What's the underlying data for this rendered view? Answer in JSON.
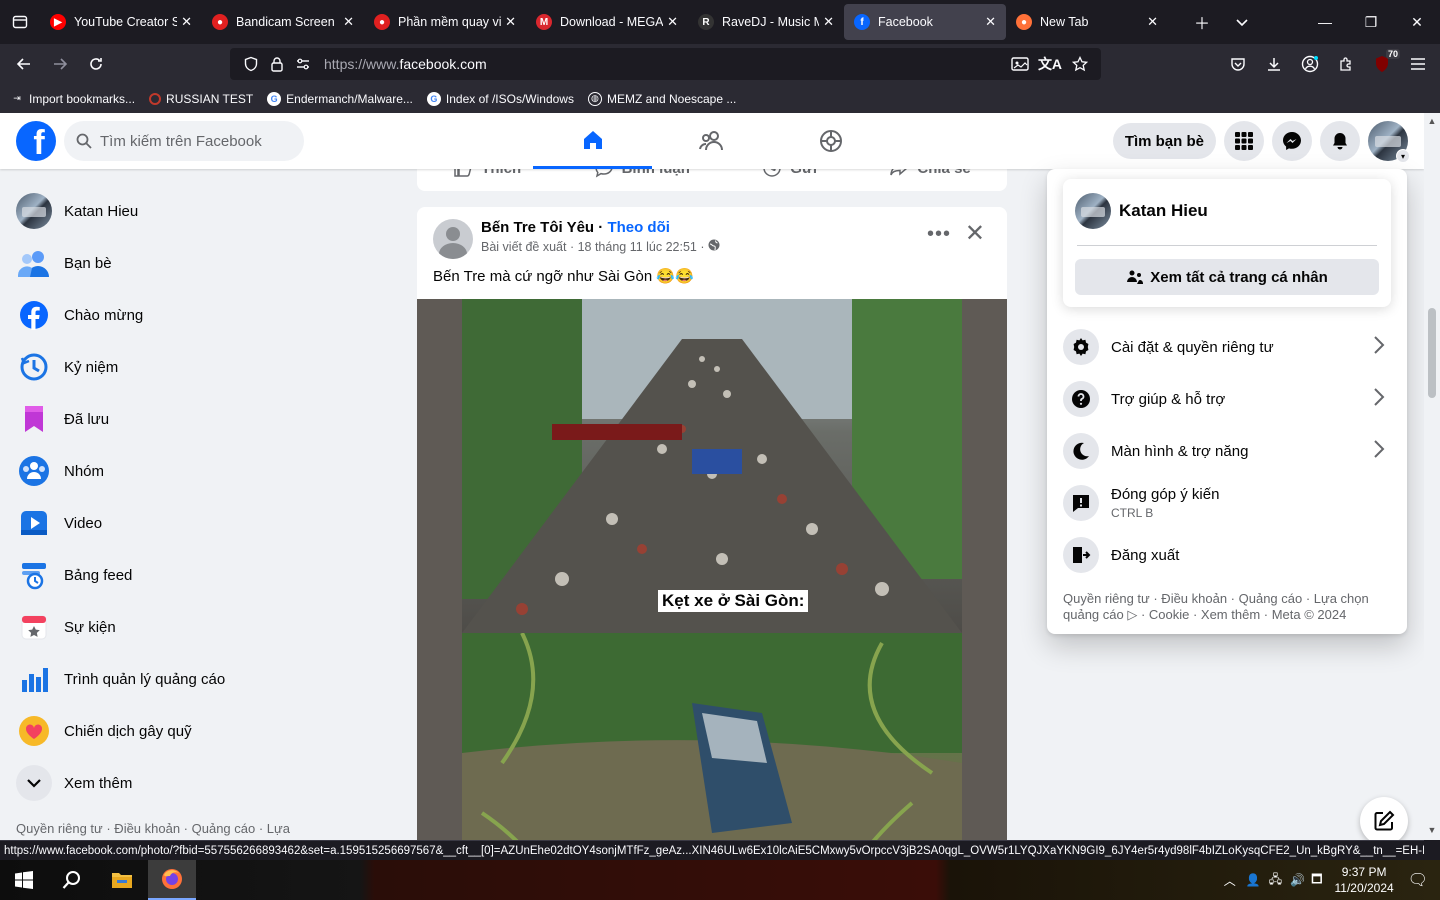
{
  "browser": {
    "tabs": [
      {
        "title": "YouTube Creator St",
        "icon": "youtube-icon",
        "color": "#ff0000"
      },
      {
        "title": "Bandicam Screen Re",
        "icon": "bandicam-icon",
        "color": "#e02020"
      },
      {
        "title": "Phần mềm quay vid",
        "icon": "bandicam-icon",
        "color": "#e02020"
      },
      {
        "title": "Download - MEGA",
        "icon": "mega-icon",
        "color": "#d9272e"
      },
      {
        "title": "RaveDJ - Music Mix",
        "icon": "ravedj-icon",
        "color": "#333333"
      },
      {
        "title": "Facebook",
        "icon": "facebook-icon",
        "color": "#0866ff",
        "active": true
      },
      {
        "title": "New Tab",
        "icon": "firefox-icon",
        "color": "#ff7139"
      }
    ],
    "url_dim": "https://www.",
    "url_main": "facebook.com",
    "extension_badge": "70",
    "bookmarks": [
      {
        "label": "Import bookmarks...",
        "icon": "import-icon"
      },
      {
        "label": "RUSSIAN TEST",
        "icon": "russian-test-icon"
      },
      {
        "label": "Endermanch/Malware...",
        "icon": "google-icon"
      },
      {
        "label": "Index of /ISOs/Windows",
        "icon": "google-icon"
      },
      {
        "label": "MEMZ and Noescape ...",
        "icon": "globe-icon"
      }
    ],
    "status_url": "https://www.facebook.com/photo/?fbid=557556266893462&set=a.159515256697567&__cft__[0]=AZUnEhe02dtOY4sonjMTfFz_geAz...XIN46ULw6Ex10lcAiE5CMxwy5vOrpccV3jB2SA0qgL_OVW5r1LYQJXaYKN9GI9_6JY4er5r4yd98lF4bIZLoKysqCFE2_Un_kBgRY&__tn__=EH-R"
  },
  "fb": {
    "search_placeholder": "Tìm kiếm trên Facebook",
    "find_friends": "Tìm bạn bè",
    "sidebar": [
      {
        "label": "Katan Hieu",
        "icon": "profile-avatar"
      },
      {
        "label": "Bạn bè",
        "icon": "friends-icon"
      },
      {
        "label": "Chào mừng",
        "icon": "facebook-icon"
      },
      {
        "label": "Kỷ niệm",
        "icon": "memories-clock-icon"
      },
      {
        "label": "Đã lưu",
        "icon": "saved-bookmark-icon"
      },
      {
        "label": "Nhóm",
        "icon": "groups-icon"
      },
      {
        "label": "Video",
        "icon": "video-icon"
      },
      {
        "label": "Bảng feed",
        "icon": "feeds-icon"
      },
      {
        "label": "Sự kiện",
        "icon": "events-icon"
      },
      {
        "label": "Trình quản lý quảng cáo",
        "icon": "ads-manager-icon"
      },
      {
        "label": "Chiến dịch gây quỹ",
        "icon": "fundraiser-icon"
      },
      {
        "label": "Xem thêm",
        "icon": "chevron-down-icon"
      }
    ],
    "sidebar_footer": "Quyền riêng tư · Điều khoản · Quảng cáo · Lựa",
    "prev_actions": [
      "Thích",
      "Bình luận",
      "Gửi",
      "Chia sẻ"
    ],
    "post": {
      "author": "Bến Tre Tôi Yêu",
      "sep": " · ",
      "follow": "Theo dõi",
      "sub": "Bài viết đề xuất · 18 tháng 11 lúc 22:51 ·",
      "text": "Bến Tre mà cứ ngỡ như Sài Gòn 😂😂",
      "caption": "Kẹt xe ở Sài Gòn:"
    },
    "account_menu": {
      "name": "Katan Hieu",
      "see_all": "Xem tất cả trang cá nhân",
      "items": [
        {
          "label": "Cài đặt & quyền riêng tư",
          "icon": "settings-gear-icon",
          "chevron": true
        },
        {
          "label": "Trợ giúp & hỗ trợ",
          "icon": "help-icon",
          "chevron": true
        },
        {
          "label": "Màn hình & trợ năng",
          "icon": "moon-icon",
          "chevron": true
        },
        {
          "label": "Đóng góp ý kiến",
          "sub": "CTRL B",
          "icon": "feedback-icon",
          "chevron": false
        },
        {
          "label": "Đăng xuất",
          "icon": "logout-icon",
          "chevron": false
        }
      ],
      "footer": "Quyền riêng tư · Điều khoản · Quảng cáo · Lựa chọn quảng cáo ▷ · Cookie · Xem thêm · Meta © 2024"
    }
  },
  "taskbar": {
    "time": "9:37 PM",
    "date": "11/20/2024"
  },
  "colors": {
    "fb_blue": "#0866ff",
    "page_bg": "#f0f2f5",
    "chrome_dark": "#1c1b22"
  }
}
